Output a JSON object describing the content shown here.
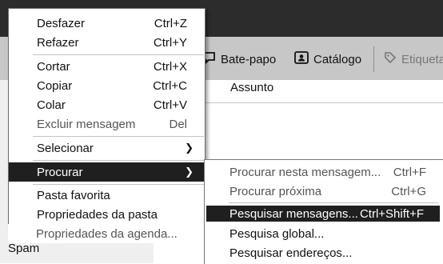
{
  "toolbar": {
    "chat_label": "Bate-papo",
    "catalog_label": "Catálogo",
    "tags_label": "Etiqueta"
  },
  "message_list": {
    "subject_header": "Assunto"
  },
  "folders": {
    "spam_label": "Spam"
  },
  "context_menu": {
    "items": [
      {
        "label": "Desfazer",
        "shortcut": "Ctrl+Z"
      },
      {
        "label": "Refazer",
        "shortcut": "Ctrl+Y"
      },
      {
        "label": "Cortar",
        "shortcut": "Ctrl+X"
      },
      {
        "label": "Copiar",
        "shortcut": "Ctrl+C"
      },
      {
        "label": "Colar",
        "shortcut": "Ctrl+V"
      },
      {
        "label": "Excluir mensagem",
        "shortcut": "Del"
      },
      {
        "label": "Selecionar",
        "shortcut": ""
      },
      {
        "label": "Procurar",
        "shortcut": ""
      },
      {
        "label": "Pasta favorita",
        "shortcut": ""
      },
      {
        "label": "Propriedades da pasta",
        "shortcut": ""
      },
      {
        "label": "Propriedades da agenda...",
        "shortcut": ""
      }
    ]
  },
  "submenu": {
    "items": [
      {
        "label": "Procurar nesta mensagem...",
        "shortcut": "Ctrl+F"
      },
      {
        "label": "Procurar próxima",
        "shortcut": "Ctrl+G"
      },
      {
        "label": "Pesquisar mensagens...",
        "shortcut": "Ctrl+Shift+F"
      },
      {
        "label": "Pesquisa global...",
        "shortcut": ""
      },
      {
        "label": "Pesquisar endereços...",
        "shortcut": ""
      }
    ]
  },
  "colors": {
    "highlight_bg": "#1f1f1f",
    "highlight_fg": "#ffffff",
    "toolbar_bg": "#c7c7c7",
    "titlebar_bg": "#2c2c2c"
  }
}
